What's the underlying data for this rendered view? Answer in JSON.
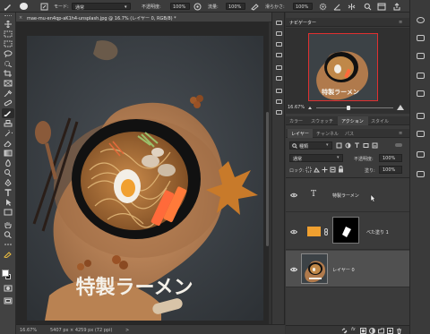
{
  "option_bar": {
    "mode_label": "モード:",
    "mode_value": "通常",
    "opacity_label": "不透明度:",
    "opacity_value": "100%",
    "flow_label": "流量:",
    "flow_value": "100%",
    "smoothing_label": "滑らかさ:",
    "smoothing_value": "100%"
  },
  "document": {
    "tab_title": "mae-mu-en4qp-aK1h4-unsplash.jpg @ 16.7% (レイヤー 0, RGB/8) *",
    "close_glyph": "×"
  },
  "canvas_art": {
    "title_text": "特製ラーメン"
  },
  "status_bar": {
    "zoom": "16.67%",
    "doc_info": "5407 px × 4259 px (72 ppi)",
    "arrow": ">"
  },
  "navigator": {
    "tab_label": "ナビゲーター",
    "zoom_value": "16.67%",
    "preview_text": "特製ラーメン"
  },
  "panel_tabs": {
    "items": [
      "カラー",
      "スウォッチ",
      "アクション",
      "スタイル"
    ],
    "active": "アクション"
  },
  "layers_panel": {
    "tabs": [
      "レイヤー",
      "チャンネル",
      "パス"
    ],
    "active_tab": "レイヤー",
    "filter_value": "種類",
    "blend_value": "通常",
    "opacity_label": "不透明度:",
    "opacity_value": "100%",
    "lock_label": "ロック:",
    "fill_label": "塗り:",
    "fill_value": "100%",
    "layers": [
      {
        "name": "特製ラーメン",
        "kind": "text",
        "thumb_glyph": "T",
        "selected": false
      },
      {
        "name": "べた塗り 1",
        "kind": "fill",
        "fill_color": "#f0a030",
        "selected": false
      },
      {
        "name": "レイヤー 0",
        "kind": "image",
        "selected": true
      }
    ]
  },
  "colors": {
    "accent_orange": "#f0a030",
    "selected_layer": "#505050",
    "navigator_frame": "#e03030"
  }
}
